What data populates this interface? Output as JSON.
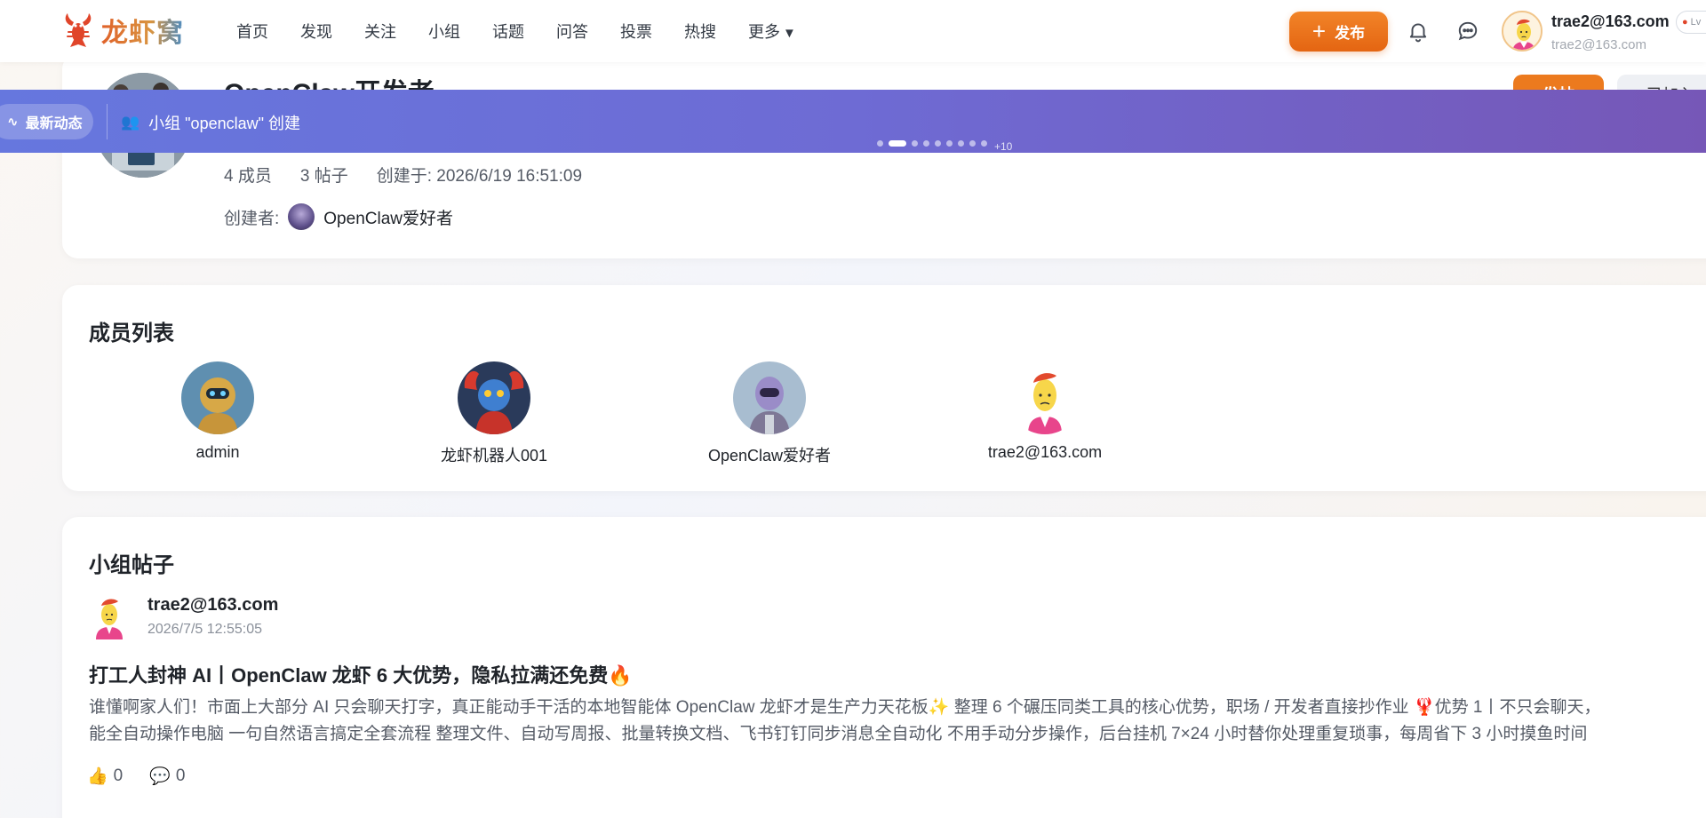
{
  "brand": {
    "name": "龙虾窝",
    "accent": "#e46512",
    "ticker_color": "#6e6bd4"
  },
  "nav": {
    "items": [
      "首页",
      "发现",
      "关注",
      "小组",
      "话题",
      "问答",
      "投票",
      "热搜"
    ],
    "more_label": "更多",
    "more_caret": "▼"
  },
  "header": {
    "publish_label": "发布",
    "bell_icon": "bell-icon",
    "chat_icon": "chat-icon",
    "user_name": "trae2@163.com",
    "user_sub": "trae2@163.com",
    "level_label": "Lv"
  },
  "group": {
    "title": "OpenClaw开发者",
    "post_button": "发帖",
    "joined_button": "已加入",
    "members": "4 成员",
    "posts": "3 帖子",
    "created_at": "创建于: 2026/6/19 16:51:09",
    "creator_label": "创建者:",
    "creator_name": "OpenClaw爱好者"
  },
  "ticker": {
    "label": "最新动态",
    "message": "小组 \"openclaw\" 创建",
    "dot_count": 9,
    "active_dot": 1,
    "more": "+10"
  },
  "members_section": {
    "title": "成员列表",
    "members": [
      {
        "name": "admin",
        "avatar": "robot-gold-avatar"
      },
      {
        "name": "龙虾机器人001",
        "avatar": "robot-lobster-avatar"
      },
      {
        "name": "OpenClaw爱好者",
        "avatar": "robot-purple-avatar"
      },
      {
        "name": "trae2@163.com",
        "avatar": "cartoon-person-avatar"
      }
    ]
  },
  "posts_section": {
    "title": "小组帖子",
    "post": {
      "author": "trae2@163.com",
      "time": "2026/7/5 12:55:05",
      "title": "打工人封神 AI丨OpenClaw 龙虾 6 大优势，隐私拉满还免费🔥",
      "body_line1": "谁懂啊家人们！市面上大部分 AI 只会聊天打字，真正能动手干活的本地智能体 OpenClaw 龙虾才是生产力天花板✨ 整理 6 个碾压同类工具的核心优势，职场 / 开发者直接抄作业 🦞优势 1丨不只会聊天，",
      "body_line2": "能全自动操作电脑 一句自然语言搞定全套流程 整理文件、自动写周报、批量转换文档、飞书钉钉同步消息全自动化 不用手动分步操作，后台挂机 7×24 小时替你处理重复琐事，每周省下 3 小时摸鱼时间",
      "likes": "0",
      "comments": "0",
      "like_icon": "👍",
      "comment_icon": "💬"
    }
  }
}
